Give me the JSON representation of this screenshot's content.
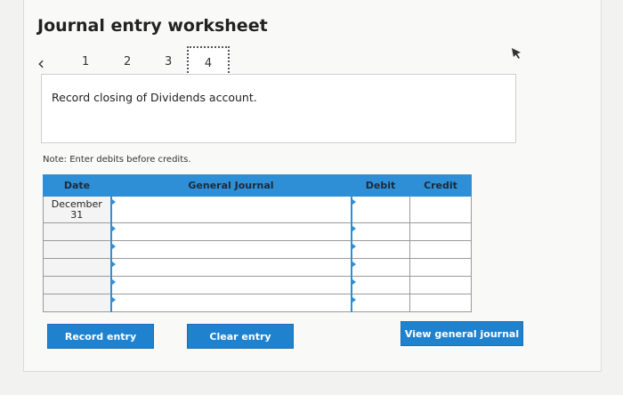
{
  "title": "Journal entry worksheet",
  "stepper": {
    "prev_icon": "chevron-left-icon",
    "steps": [
      "1",
      "2",
      "3",
      "4"
    ],
    "active_step": "4"
  },
  "pin_icon": "pin-icon",
  "instruction": "Record closing of Dividends account.",
  "note": "Note: Enter debits before credits.",
  "table": {
    "headers": [
      "Date",
      "General Journal",
      "Debit",
      "Credit"
    ],
    "rows": [
      {
        "date_line1": "December",
        "date_line2": "31",
        "account": "",
        "debit": "",
        "credit": ""
      },
      {
        "date_line1": "",
        "date_line2": "",
        "account": "",
        "debit": "",
        "credit": ""
      },
      {
        "date_line1": "",
        "date_line2": "",
        "account": "",
        "debit": "",
        "credit": ""
      },
      {
        "date_line1": "",
        "date_line2": "",
        "account": "",
        "debit": "",
        "credit": ""
      },
      {
        "date_line1": "",
        "date_line2": "",
        "account": "",
        "debit": "",
        "credit": ""
      },
      {
        "date_line1": "",
        "date_line2": "",
        "account": "",
        "debit": "",
        "credit": ""
      }
    ]
  },
  "buttons": {
    "record": "Record entry",
    "clear": "Clear entry",
    "view": "View general journal"
  },
  "colors": {
    "accent": "#2f8fd6",
    "button": "#1f82cf"
  }
}
